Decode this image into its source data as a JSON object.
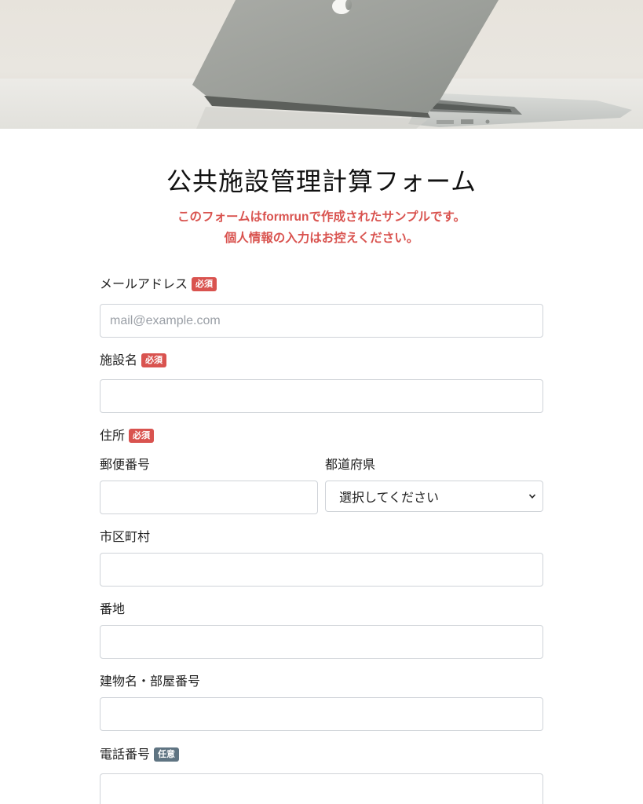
{
  "form": {
    "title": "公共施設管理計算フォーム",
    "notice_line1_prefix": "このフォームは",
    "notice_brand": "formrun",
    "notice_line1_suffix": "で作成されたサンプルです。",
    "notice_line2": "個人情報の入力はお控えください。"
  },
  "badges": {
    "required": "必須",
    "optional": "任意"
  },
  "fields": {
    "email": {
      "label": "メールアドレス",
      "placeholder": "mail@example.com",
      "value": ""
    },
    "facility_name": {
      "label": "施設名",
      "value": ""
    },
    "address": {
      "label": "住所"
    },
    "postal_code": {
      "label": "郵便番号",
      "value": ""
    },
    "prefecture": {
      "label": "都道府県",
      "selected": "選択してください"
    },
    "city": {
      "label": "市区町村",
      "value": ""
    },
    "street": {
      "label": "番地",
      "value": ""
    },
    "building": {
      "label": "建物名・部屋番号",
      "value": ""
    },
    "phone": {
      "label": "電話番号",
      "value": ""
    }
  },
  "colors": {
    "required_badge": "#d9534f",
    "optional_badge": "#5f7482",
    "notice_text": "#d9534f"
  }
}
